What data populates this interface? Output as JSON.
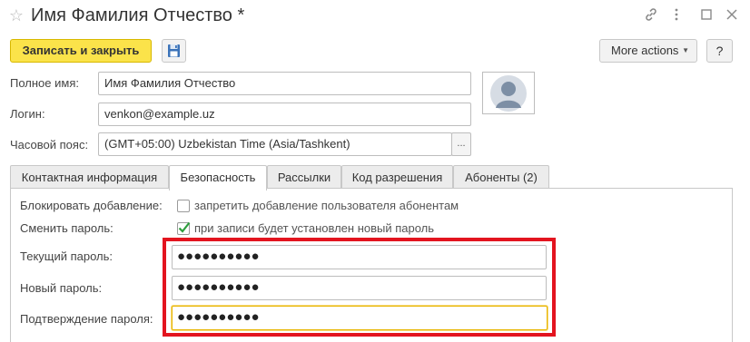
{
  "window": {
    "title": "Имя Фамилия Отчество *"
  },
  "toolbar": {
    "save_close_label": "Записать и закрыть",
    "more_actions_label": "More actions",
    "help_label": "?"
  },
  "form": {
    "full_name_label": "Полное имя:",
    "full_name_value": "Имя Фамилия Отчество",
    "login_label": "Логин:",
    "login_value": "venkon@example.uz",
    "timezone_label": "Часовой пояс:",
    "timezone_value": "(GMT+05:00) Uzbekistan Time (Asia/Tashkent)",
    "timezone_select_label": "..."
  },
  "tabs": [
    {
      "label": "Контактная информация",
      "active": false
    },
    {
      "label": "Безопасность",
      "active": true
    },
    {
      "label": "Рассылки",
      "active": false
    },
    {
      "label": "Код разрешения",
      "active": false
    },
    {
      "label": "Абоненты (2)",
      "active": false
    }
  ],
  "security": {
    "block_adding_label": "Блокировать добавление:",
    "block_adding_text": "запретить добавление пользователя абонентам",
    "block_adding_checked": false,
    "change_password_label": "Сменить пароль:",
    "change_password_text": "при записи будет установлен новый пароль",
    "change_password_checked": true,
    "current_password_label": "Текущий пароль:",
    "current_password_value": "●●●●●●●●●●",
    "new_password_label": "Новый пароль:",
    "new_password_value": "●●●●●●●●●●",
    "confirm_password_label": "Подтверждение пароля:",
    "confirm_password_value": "●●●●●●●●●●"
  },
  "colors": {
    "primary_button": "#fbe34a",
    "highlight_frame": "#e3141f",
    "focus_border": "#e8b500",
    "checkmark": "#2e9e3e"
  }
}
